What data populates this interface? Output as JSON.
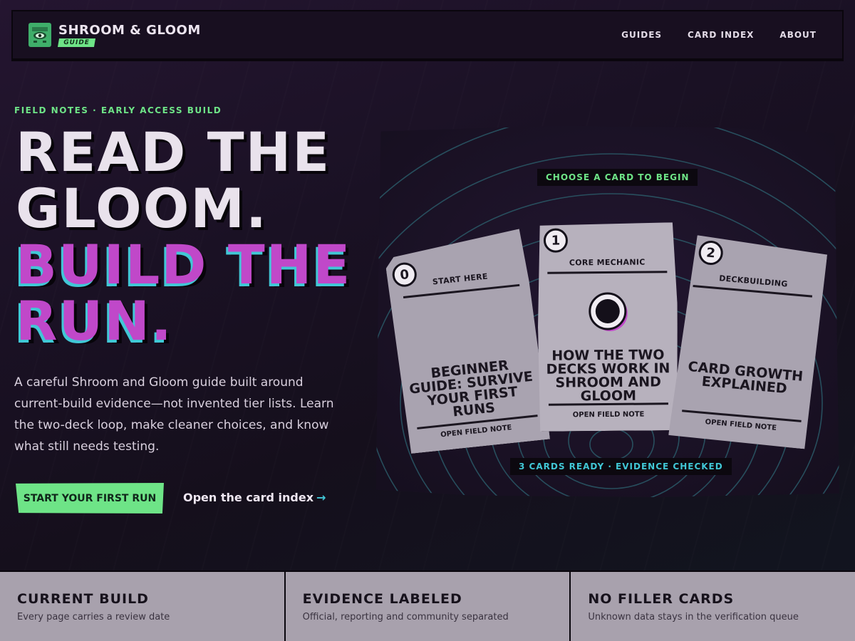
{
  "nav": {
    "brand_title": "SHROOM & GLOOM",
    "brand_badge": "GUIDE",
    "links": [
      "GUIDES",
      "CARD INDEX",
      "ABOUT"
    ]
  },
  "hero": {
    "eyebrow": "FIELD NOTES · EARLY ACCESS BUILD",
    "headline": {
      "line1": "READ THE",
      "line2": "GLOOM.",
      "line3": "BUILD THE",
      "line4": "RUN."
    },
    "lede": "A careful Shroom and Gloom guide built around current-build evidence—not invented tier lists. Learn the two-deck loop, make cleaner choices, and know what still needs testing.",
    "cta_label": "START YOUR FIRST RUN",
    "secondary_link": "Open the card index",
    "secondary_arrow": "→"
  },
  "stage": {
    "top_tag": "CHOOSE A CARD TO BEGIN",
    "bottom_tag": "3 CARDS READY · EVIDENCE CHECKED",
    "cards": [
      {
        "number": "0",
        "kicker": "START HERE",
        "title": "BEGINNER GUIDE: SURVIVE YOUR FIRST RUNS",
        "footer": "OPEN FIELD NOTE"
      },
      {
        "number": "1",
        "kicker": "CORE MECHANIC",
        "title": "HOW THE TWO DECKS WORK IN SHROOM AND GLOOM",
        "footer": "OPEN FIELD NOTE"
      },
      {
        "number": "2",
        "kicker": "DECKBUILDING",
        "title": "CARD GROWTH EXPLAINED",
        "footer": "OPEN FIELD NOTE"
      }
    ]
  },
  "strip": [
    {
      "title": "CURRENT BUILD",
      "subtitle": "Every page carries a review date"
    },
    {
      "title": "EVIDENCE LABELED",
      "subtitle": "Official, reporting and community separated"
    },
    {
      "title": "NO FILLER CARDS",
      "subtitle": "Unknown data stays in the verification queue"
    }
  ],
  "colors": {
    "accent_green": "#6ee487",
    "accent_magenta": "#c048c9",
    "accent_cyan": "#41c7d6",
    "background": "#1a1124",
    "card": "#a9a3b0"
  },
  "icons": {
    "logo": "mushroom-eye-icon",
    "core": "dark-orb-icon",
    "arrow": "arrow-right-icon"
  }
}
